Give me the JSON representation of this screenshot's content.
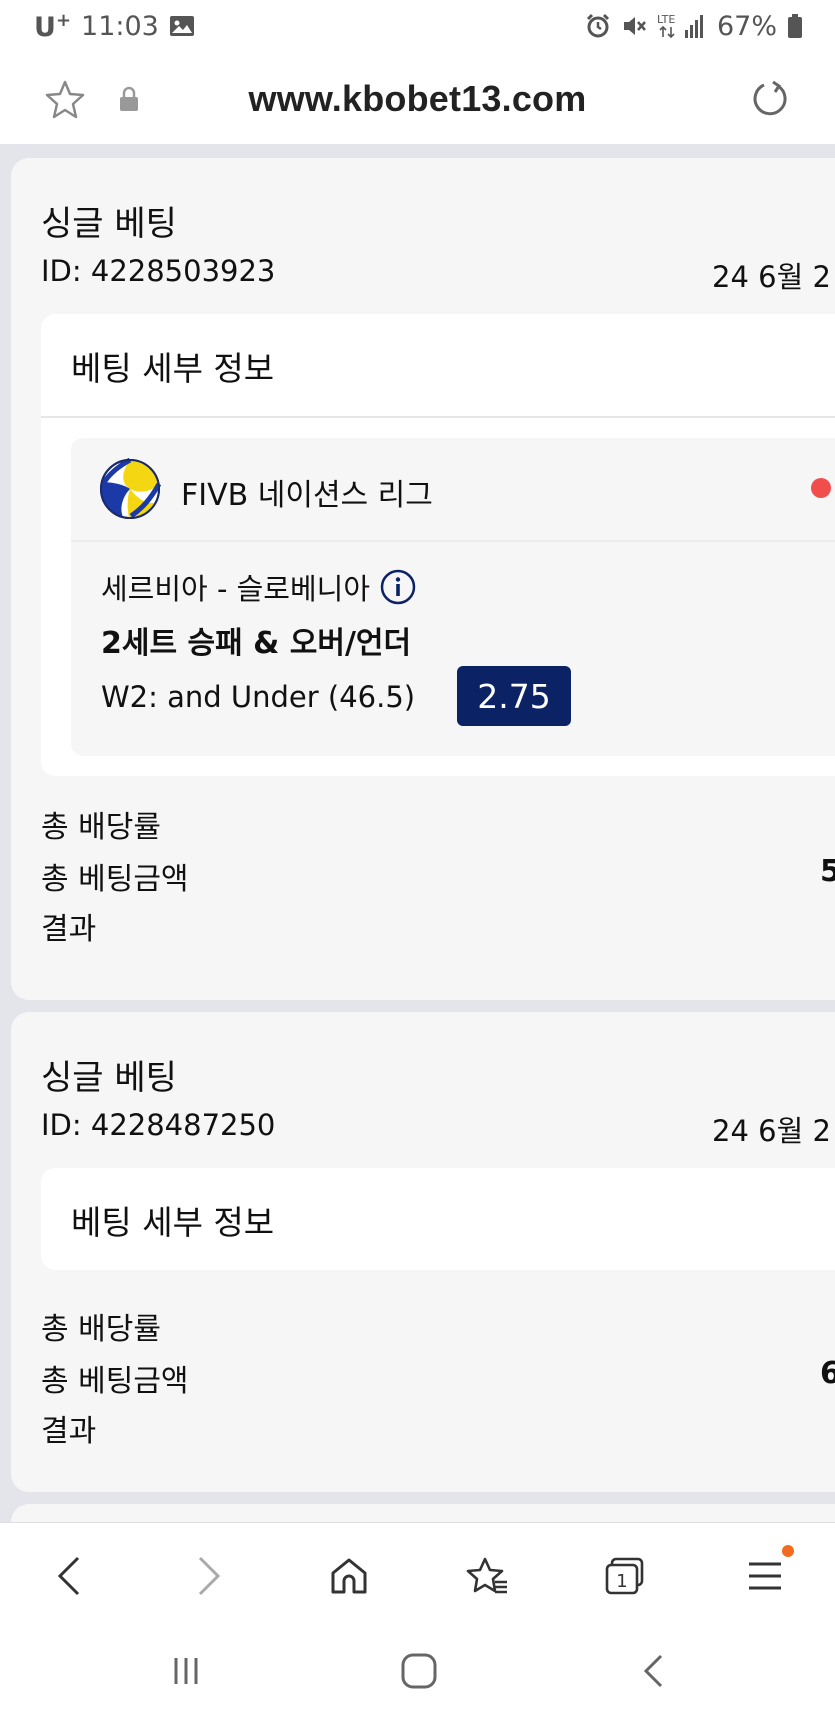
{
  "status_bar": {
    "carrier": "U",
    "carrier_sup": "+",
    "time": "11:03",
    "network": "LTE",
    "battery": "67%"
  },
  "address_bar": {
    "url": "www.kbobet13.com"
  },
  "bets": [
    {
      "type": "싱글 베팅",
      "id": "ID: 4228503923",
      "date": "24 6월 2",
      "details_title": "베팅 세부 정보",
      "selection": {
        "league": "FIVB 네이션스 리그",
        "match": "세르비아 - 슬로베니아",
        "market": "2세트 승패 & 오버/언더",
        "outcome": "W2: and Under (46.5)",
        "odds": "2.75"
      },
      "summary": {
        "total_odds_label": "총 배당률",
        "total_stake_label": "총 베팅금액",
        "total_stake_value": "5",
        "result_label": "결과"
      }
    },
    {
      "type": "싱글 베팅",
      "id": "ID: 4228487250",
      "date": "24 6월 2",
      "details_title": "베팅 세부 정보",
      "summary": {
        "total_odds_label": "총 배당률",
        "total_stake_label": "총 베팅금액",
        "total_stake_value": "6",
        "result_label": "결과"
      }
    }
  ],
  "toolbar": {
    "tabs_count": "1"
  },
  "colors": {
    "odds_badge": "#0b2265",
    "live_dot": "#f24d4d",
    "menu_notification": "#f36b21",
    "page_background": "#e3e5ea",
    "card_background": "#f6f6f7"
  }
}
